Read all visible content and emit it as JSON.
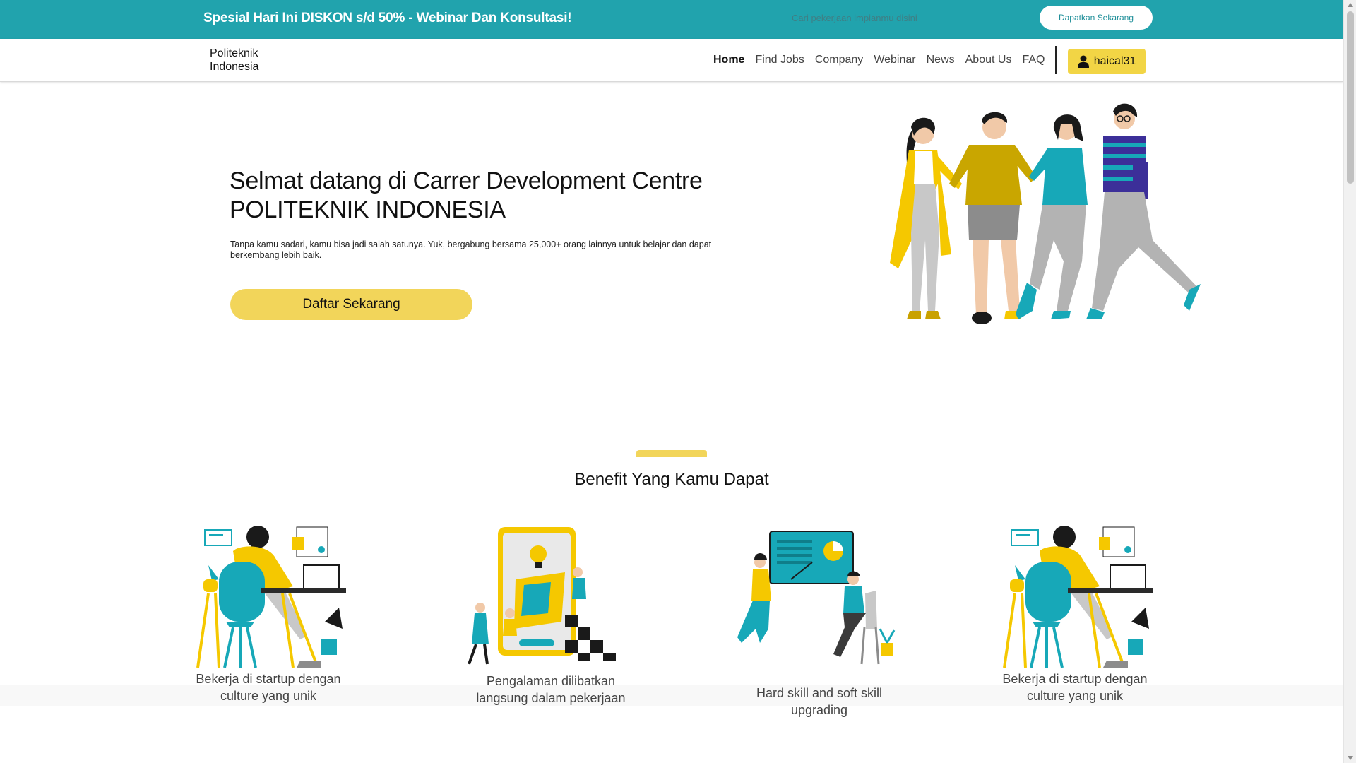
{
  "promo": {
    "headline": "Spesial Hari Ini DISKON s/d 50% - Webinar Dan Konsultasi!",
    "search_placeholder": "Cari pekerjaan impianmu disini",
    "cta_label": "Dapatkan Sekarang"
  },
  "nav": {
    "brand": "Politeknik Indonesia",
    "links": [
      "Home",
      "Find Jobs",
      "Company",
      "Webinar",
      "News",
      "About Us",
      "FAQ"
    ],
    "active": "Home",
    "user": {
      "icon": "user-icon",
      "name": "haical31"
    }
  },
  "hero": {
    "title": "Selmat datang di Carrer Development Centre POLITEKNIK INDONESIA",
    "subtitle": "Tanpa kamu sadari, kamu bisa jadi salah satunya. Yuk, bergabung bersama 25,000+ orang lainnya untuk belajar dan dapat berkembang lebih baik.",
    "cta_label": "Daftar Sekarang"
  },
  "benefits": {
    "title": "Benefit Yang Kamu Dapat",
    "items": [
      {
        "label": "Bekerja di startup dengan culture yang unik"
      },
      {
        "label": "Pengalaman dilibatkan langsung dalam pekerjaan"
      },
      {
        "label": "Hard skill and soft skill upgrading"
      },
      {
        "label": "Bekerja di startup dengan culture yang unik"
      }
    ]
  },
  "colors": {
    "teal": "#21a3ad",
    "yellow": "#f2d55a",
    "accent_teal_art": "#17a8b8",
    "accent_yellow_art": "#f5c800"
  }
}
